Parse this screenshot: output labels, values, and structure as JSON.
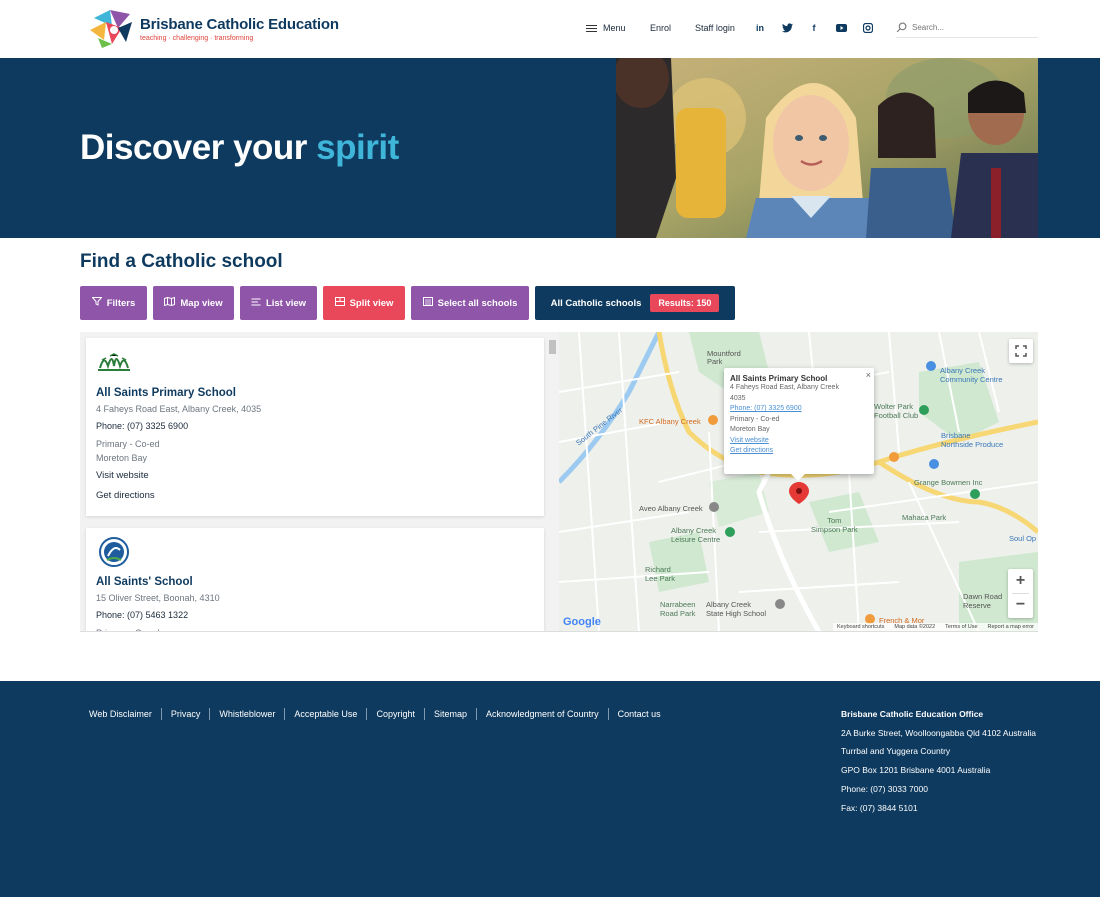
{
  "header": {
    "logo_title": "Brisbane Catholic Education",
    "logo_tagline": "teaching · challenging · transforming",
    "nav": {
      "menu": "Menu",
      "enrol": "Enrol",
      "staff_login": "Staff login"
    },
    "social_icons": [
      "linkedin-icon",
      "twitter-icon",
      "facebook-icon",
      "youtube-icon",
      "instagram-icon"
    ],
    "search_placeholder": "Search..."
  },
  "hero": {
    "title_start": "Discover your ",
    "title_accent": "spirit"
  },
  "find": {
    "title": "Find a Catholic school",
    "buttons": {
      "filters": "Filters",
      "map_view": "Map view",
      "list_view": "List view",
      "split_view": "Split view",
      "select_all": "Select all schools"
    },
    "scope_label": "All Catholic schools",
    "results_label": "Results: 150"
  },
  "schools": [
    {
      "name": "All Saints Primary School",
      "address": "4 Faheys Road East, Albany Creek, 4035",
      "phone": "Phone: (07) 3325 6900",
      "type": "Primary - Co-ed",
      "region": "Moreton Bay",
      "visit": "Visit website",
      "directions": "Get directions"
    },
    {
      "name": "All Saints' School",
      "address": "15 Oliver Street, Boonah, 4310",
      "phone": "Phone: (07) 5463 1322",
      "type": "Primary - Co-ed"
    }
  ],
  "map": {
    "popup": {
      "name": "All Saints Primary School",
      "address1": "4 Faheys Road East, Albany Creek",
      "address2": "4035",
      "phone": "Phone: (07) 3325 6900",
      "type": "Primary - Co-ed",
      "region": "Moreton Bay",
      "visit": "Visit website",
      "directions": "Get directions"
    },
    "labels": {
      "mountford": "Mountford\nPark",
      "albany_cc": "Albany Creek",
      "albany_cc2": "Community Centre",
      "wolter": "Wolter Park",
      "football": "Football Club",
      "kfc": "KFC Albany Creek",
      "northside": "Brisbane",
      "northside2": "Northside Produce",
      "grange": "Grange Bowmen Inc",
      "mahaca": "Mahaca Park",
      "aveo": "Aveo Albany Creek",
      "tom": "Tom",
      "tom2": "Simpson Park",
      "leisure": "Albany Creek",
      "leisure2": "Leisure Centre",
      "richard": "Richard",
      "richard2": "Lee Park",
      "narrabeen": "Narrabeen",
      "narrabeen2": "Road Park",
      "state_high": "Albany Creek",
      "state_high2": "State High School",
      "dawn": "Dawn Road",
      "dawn2": "Reserve",
      "soul": "Soul Op",
      "french": "French & Mor",
      "pine": "South Pine River",
      "google": "Google",
      "foot1": "Keyboard shortcuts",
      "foot2": "Map data ©2022",
      "foot3": "Terms of Use",
      "foot4": "Report a map error"
    }
  },
  "footer": {
    "links": [
      "Web Disclaimer",
      "Privacy",
      "Whistleblower",
      "Acceptable Use",
      "Copyright",
      "Sitemap",
      "Acknowledgment of Country",
      "Contact us"
    ],
    "office": {
      "title": "Brisbane Catholic Education Office",
      "line1": "2A Burke Street, Woolloongabba Qld 4102 Australia",
      "line2": "Turrbal and Yuggera Country",
      "line3": "GPO Box 1201 Brisbane 4001 Australia",
      "line4": "Phone: (07) 3033 7000",
      "line5": "Fax: (07) 3844 5101"
    }
  },
  "colors": {
    "navy": "#0e3a5f",
    "purple": "#8e55a9",
    "red": "#e8485a",
    "accent": "#3fb6d9"
  }
}
